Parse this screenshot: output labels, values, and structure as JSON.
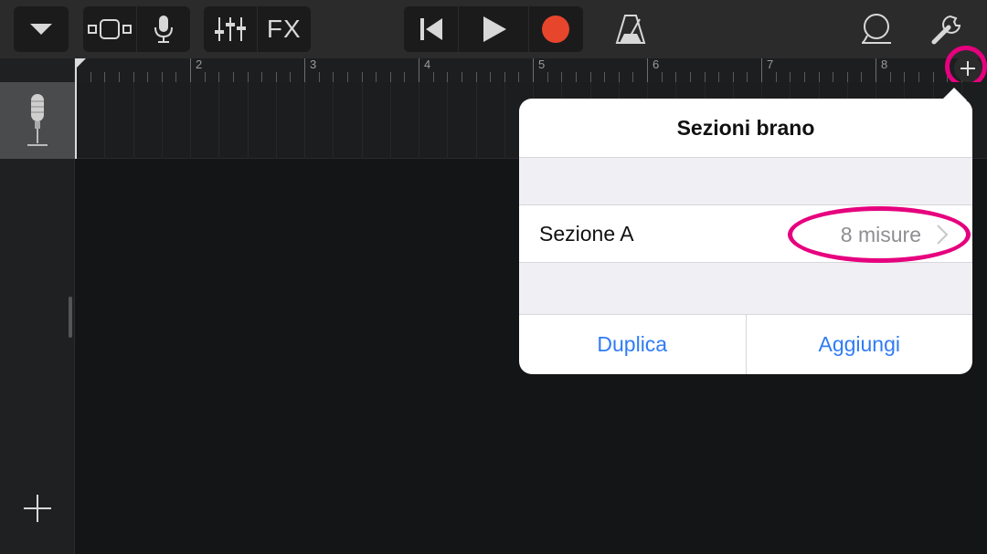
{
  "toolbar": {
    "fx_label": "FX",
    "record_color": "#e8452d",
    "icons": [
      "dropdown-arrow-icon",
      "track-view-icon",
      "microphone-icon",
      "mixer-icon",
      "rewind-icon",
      "play-icon",
      "record-icon",
      "metronome-icon",
      "loop-icon",
      "wrench-icon"
    ]
  },
  "ruler": {
    "bar_numbers": [
      "2",
      "3",
      "4",
      "5",
      "6",
      "7",
      "8"
    ]
  },
  "track": {
    "instrument_icon": "microphone-icon"
  },
  "popover": {
    "title": "Sezioni brano",
    "section_label": "Sezione A",
    "section_length": "8 misure",
    "duplicate_label": "Duplica",
    "add_label": "Aggiungi"
  },
  "colors": {
    "highlight": "#e6007e",
    "action_blue": "#2f7cf6"
  }
}
